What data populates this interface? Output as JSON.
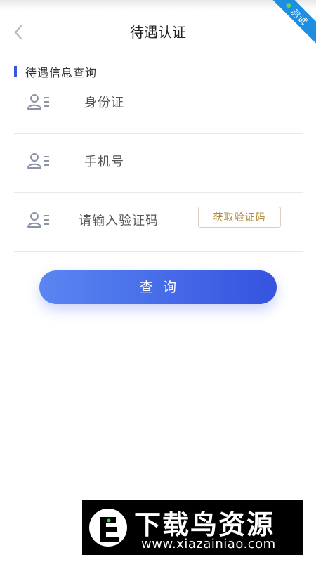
{
  "header": {
    "title": "待遇认证",
    "back_icon": "chevron-left-icon"
  },
  "ribbon": {
    "label": "测试",
    "color": "#1e8fe0"
  },
  "section": {
    "label": "待遇信息查询",
    "accent_color": "#3a55e6"
  },
  "form": {
    "id_card": {
      "placeholder": "身份证",
      "value": ""
    },
    "phone": {
      "placeholder": "手机号",
      "value": ""
    },
    "code": {
      "placeholder": "请输入验证码",
      "value": ""
    },
    "get_code_label": "获取验证码"
  },
  "query_button": {
    "label": "查询",
    "color_start": "#5a86f2",
    "color_end": "#3553df"
  },
  "watermark": {
    "title": "下载鸟资源",
    "url": "www.xiazainiao.com"
  }
}
